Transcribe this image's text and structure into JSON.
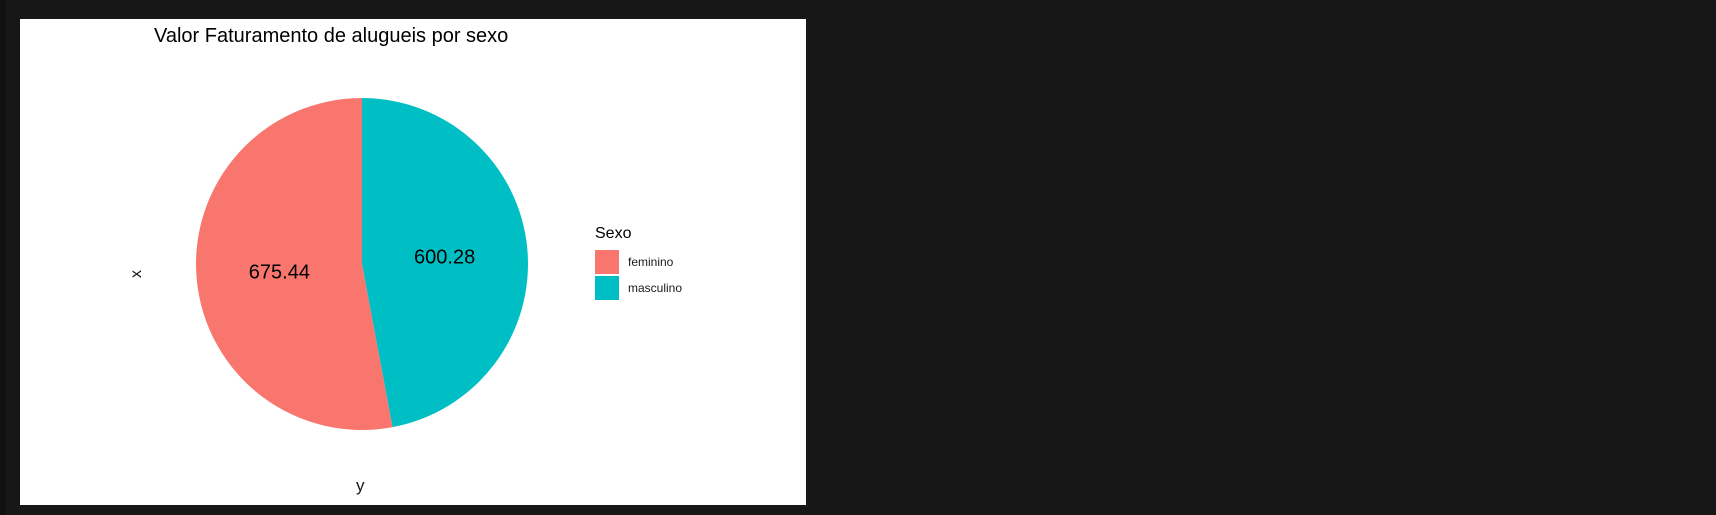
{
  "chart_data": {
    "type": "pie",
    "title": "Valor Faturamento de alugueis por sexo",
    "xlabel": "y",
    "ylabel": "x",
    "legend_title": "Sexo",
    "legend_position": "right",
    "categories": [
      "feminino",
      "masculino"
    ],
    "values": [
      675.44,
      600.28
    ],
    "value_labels": [
      "675.44",
      "600.28"
    ],
    "colors": [
      "#F8766D",
      "#00BFC4"
    ],
    "grid": false
  }
}
